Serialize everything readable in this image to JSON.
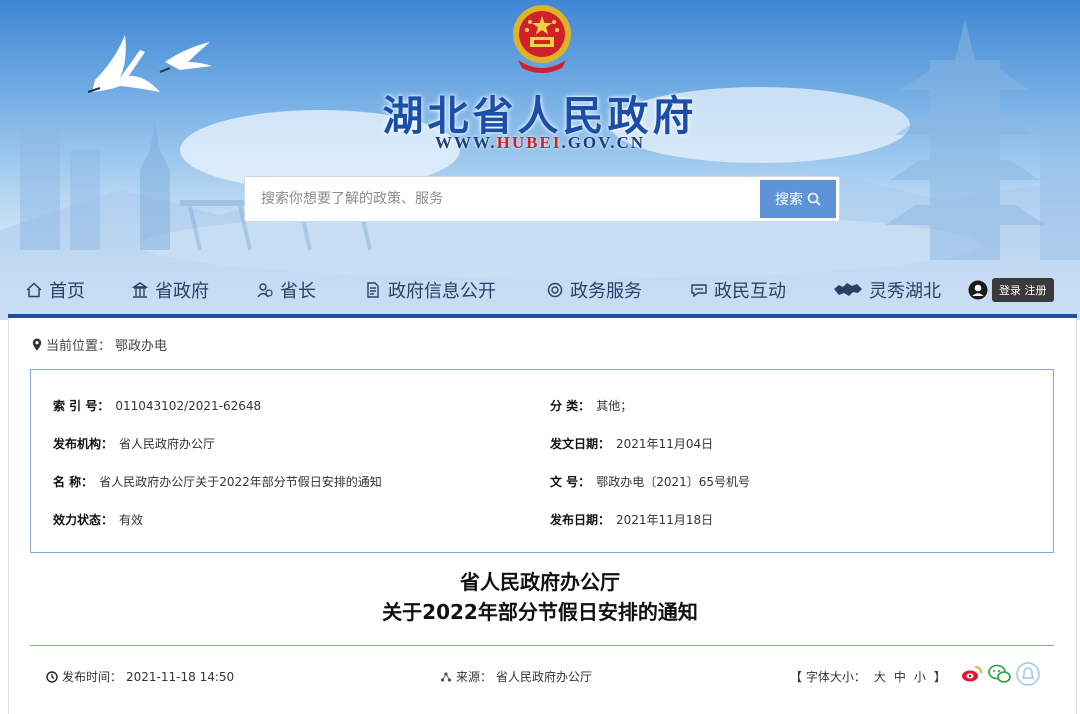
{
  "header": {
    "site_title": "湖北省人民政府",
    "site_url_prefix": "WWW.",
    "site_url_domain": "HUBEI",
    "site_url_suffix": ".GOV.CN"
  },
  "search": {
    "placeholder": "搜索你想要了解的政策、服务",
    "button_label": "搜索"
  },
  "nav": {
    "items": [
      {
        "label": "首页",
        "icon": "home-icon"
      },
      {
        "label": "省政府",
        "icon": "building-icon"
      },
      {
        "label": "省长",
        "icon": "user-group-icon"
      },
      {
        "label": "政府信息公开",
        "icon": "document-icon"
      },
      {
        "label": "政务服务",
        "icon": "service-icon"
      },
      {
        "label": "政民互动",
        "icon": "chat-icon"
      },
      {
        "label": "灵秀湖北",
        "icon": "province-map-icon"
      }
    ],
    "login": "登录",
    "register": "注册"
  },
  "breadcrumb": {
    "label": "当前位置：",
    "current": "鄂政办电"
  },
  "meta": {
    "index_key": "索 引 号：",
    "index_value": "011043102/2021-62648",
    "category_key": "分    类：",
    "category_value": "其他；",
    "issuer_key": "发布机构：",
    "issuer_value": "省人民政府办公厅",
    "issue_date_key": "发文日期：",
    "issue_date_value": "2021年11月04日",
    "name_key": "名    称：",
    "name_value": "省人民政府办公厅关于2022年部分节假日安排的通知",
    "doc_no_key": "文    号：",
    "doc_no_value": "鄂政办电〔2021〕65号机号",
    "status_key": "效力状态：",
    "status_value": "有效",
    "publish_date_key": "发布日期：",
    "publish_date_value": "2021年11月18日"
  },
  "document": {
    "title_line1": "省人民政府办公厅",
    "title_line2": "关于2022年部分节假日安排的通知"
  },
  "info_bar": {
    "publish_time_label": "发布时间：",
    "publish_time_value": "2021-11-18 14:50",
    "source_label": "来源：",
    "source_value": "省人民政府办公厅",
    "font_size_label": "【 字体大小：",
    "font_large": "大",
    "font_medium": "中",
    "font_small": "小",
    "font_close": "】"
  },
  "colors": {
    "brand_blue": "#1a4ea8",
    "nav_rule": "#1f4e9c",
    "search_button": "#5f93d7",
    "meta_border": "#8aa6d8",
    "accent_red": "#c9242b"
  }
}
